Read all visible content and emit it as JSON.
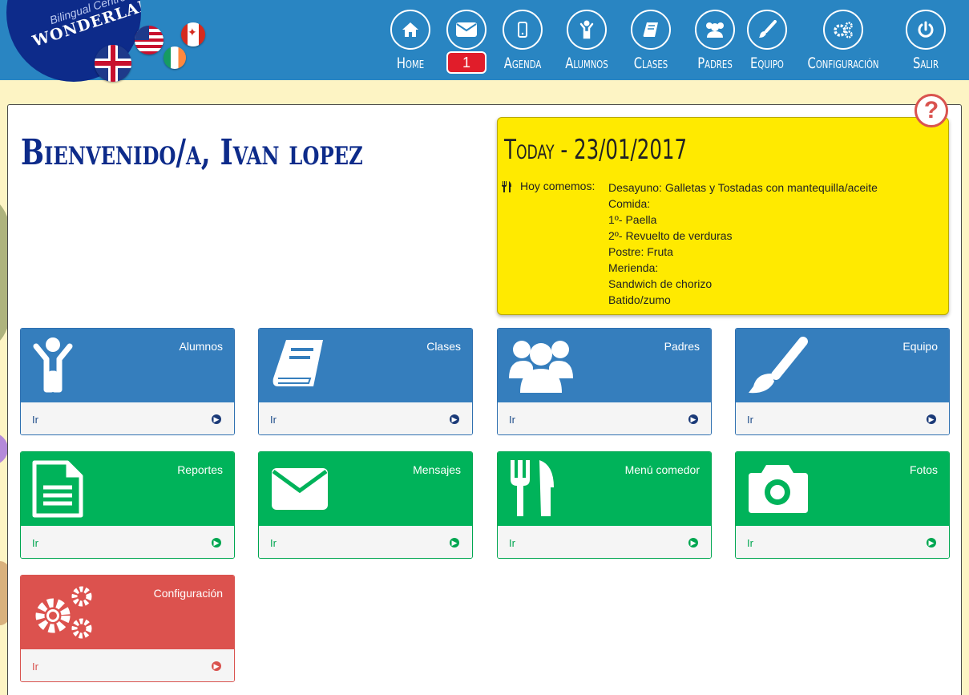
{
  "brand": {
    "subtitle": "Bilingual Centre",
    "name": "WONDERLAND"
  },
  "nav": [
    {
      "label": "Home",
      "icon": "home-icon"
    },
    {
      "badge": "1",
      "icon": "envelope-icon"
    },
    {
      "label": "Agenda",
      "icon": "mobile-icon"
    },
    {
      "label": "Alumnos",
      "icon": "child-icon"
    },
    {
      "label": "Clases",
      "icon": "book-icon"
    },
    {
      "label": "Padres",
      "icon": "users-icon"
    },
    {
      "label": "Equipo",
      "icon": "brush-icon"
    },
    {
      "label": "Configuración",
      "icon": "gears-icon"
    },
    {
      "label": "Salir",
      "icon": "power-icon"
    }
  ],
  "welcome": "Bienvenido/a, Ivan lopez",
  "help": "?",
  "today": {
    "title": "Today - 23/01/2017",
    "menu_label": "Hoy comemos:",
    "lines": [
      "Desayuno: Galletas y Tostadas con mantequilla/aceite",
      "Comida:",
      "1º- Paella",
      "2º- Revuelto de verduras",
      "Postre: Fruta",
      "Merienda:",
      "Sandwich de chorizo",
      "Batido/zumo"
    ]
  },
  "tiles": [
    {
      "title": "Alumnos",
      "link": "Ir",
      "icon": "child-icon",
      "color": "#357ebd"
    },
    {
      "title": "Clases",
      "link": "Ir",
      "icon": "book-icon",
      "color": "#357ebd"
    },
    {
      "title": "Padres",
      "link": "Ir",
      "icon": "users-icon",
      "color": "#357ebd"
    },
    {
      "title": "Equipo",
      "link": "Ir",
      "icon": "brush-icon",
      "color": "#357ebd"
    },
    {
      "title": "Reportes",
      "link": "Ir",
      "icon": "document-icon",
      "color": "#00b35a"
    },
    {
      "title": "Mensajes",
      "link": "Ir",
      "icon": "envelope-icon",
      "color": "#00b35a"
    },
    {
      "title": "Menú comedor",
      "link": "Ir",
      "icon": "cutlery-icon",
      "color": "#00b35a"
    },
    {
      "title": "Fotos",
      "link": "Ir",
      "icon": "camera-icon",
      "color": "#00b35a"
    },
    {
      "title": "Configuración",
      "link": "Ir",
      "icon": "gears-icon",
      "color": "#dc524e"
    }
  ]
}
